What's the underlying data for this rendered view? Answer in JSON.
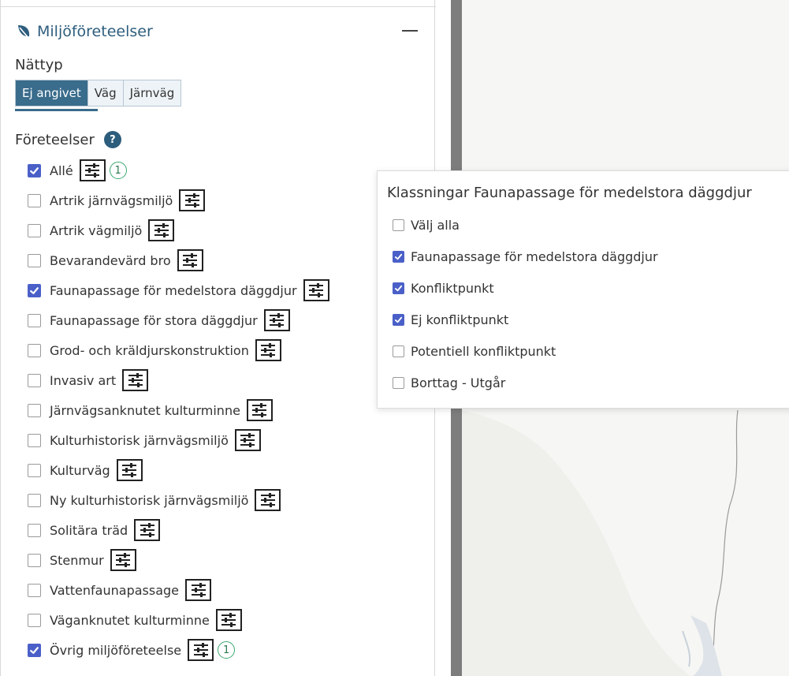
{
  "panel": {
    "title": "Miljöföreteelser",
    "collapse_label": "—",
    "nettyp": {
      "label": "Nättyp",
      "options": [
        "Ej angivet",
        "Väg",
        "Järnväg"
      ],
      "selected": "Ej angivet"
    },
    "foreteelser_label": "Företeelser",
    "help_symbol": "?",
    "items": [
      {
        "label": "Allé",
        "checked": true,
        "count": "1"
      },
      {
        "label": "Artrik järnvägsmiljö",
        "checked": false
      },
      {
        "label": "Artrik vägmiljö",
        "checked": false
      },
      {
        "label": "Bevarandevärd bro",
        "checked": false
      },
      {
        "label": "Faunapassage för medelstora däggdjur",
        "checked": true
      },
      {
        "label": "Faunapassage för stora däggdjur",
        "checked": false
      },
      {
        "label": "Grod- och kräldjurskonstruktion",
        "checked": false
      },
      {
        "label": "Invasiv art",
        "checked": false
      },
      {
        "label": "Järnvägsanknutet kulturminne",
        "checked": false
      },
      {
        "label": "Kulturhistorisk järnvägsmiljö",
        "checked": false
      },
      {
        "label": "Kulturväg",
        "checked": false
      },
      {
        "label": "Ny kulturhistorisk järnvägsmiljö",
        "checked": false
      },
      {
        "label": "Solitära träd",
        "checked": false
      },
      {
        "label": "Stenmur",
        "checked": false
      },
      {
        "label": "Vattenfaunapassage",
        "checked": false
      },
      {
        "label": "Väganknutet kulturminne",
        "checked": false
      },
      {
        "label": "Övrig miljöföreteelse",
        "checked": true,
        "count": "1"
      }
    ]
  },
  "popup": {
    "title": "Klassningar Faunapassage för medelstora däggdjur",
    "items": [
      {
        "label": "Välj alla",
        "checked": false
      },
      {
        "label": "Faunapassage för medelstora däggdjur",
        "checked": true
      },
      {
        "label": "Konfliktpunkt",
        "checked": true
      },
      {
        "label": "Ej konfliktpunkt",
        "checked": true
      },
      {
        "label": "Potentiell konfliktpunkt",
        "checked": false
      },
      {
        "label": "Borttag - Utgår",
        "checked": false
      }
    ]
  },
  "colors": {
    "accent": "#3a6c8c",
    "checkbox": "#4a60c8",
    "badge": "#3aa870",
    "divider": "#7d7d7d",
    "map_land": "#f6f6f4",
    "map_water": "#dde3e8"
  },
  "icons": {
    "title_icon": "leaf-icon",
    "filter_icon": "sliders-icon",
    "help_icon": "question-icon"
  }
}
